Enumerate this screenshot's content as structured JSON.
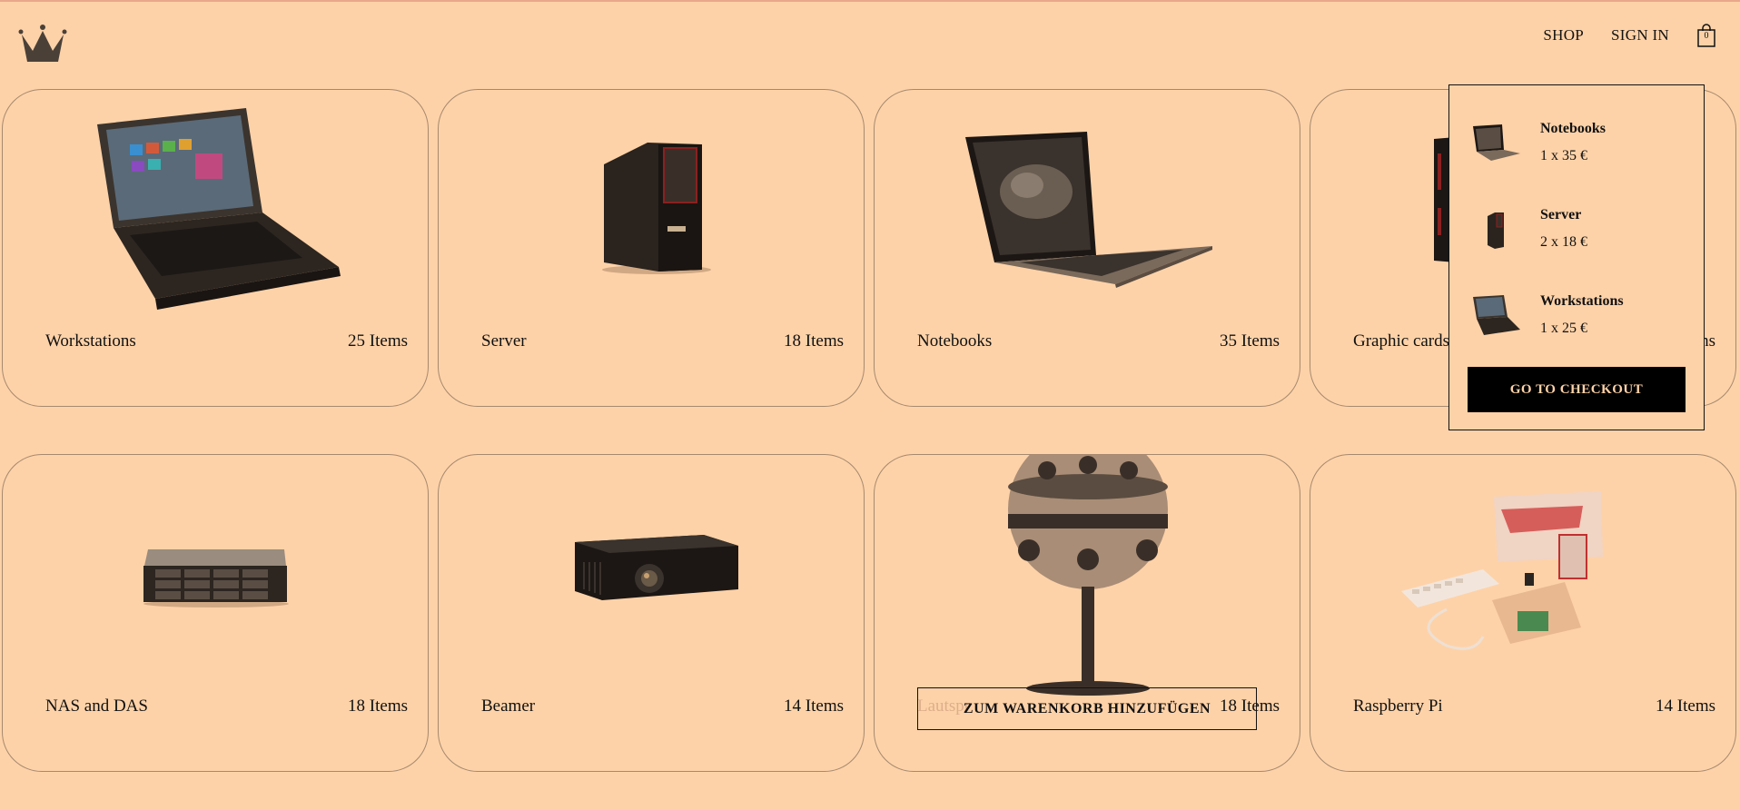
{
  "header": {
    "logo_icon": "crown-icon",
    "nav": {
      "shop": "SHOP",
      "sign_in": "SIGN IN"
    },
    "cart": {
      "icon": "shopping-bag-icon",
      "count": "0"
    }
  },
  "categories": [
    {
      "name": "Workstations",
      "count": "25 Items"
    },
    {
      "name": "Server",
      "count": "18 Items"
    },
    {
      "name": "Notebooks",
      "count": "35 Items"
    },
    {
      "name": "Graphic cards",
      "count": "ns"
    },
    {
      "name": "NAS and DAS",
      "count": "18 Items"
    },
    {
      "name": "Beamer",
      "count": "14 Items"
    },
    {
      "name": "Lautspr",
      "count": "18 Items"
    },
    {
      "name": "Raspberry Pi",
      "count": "14 Items"
    }
  ],
  "add_to_cart_button": "ZUM WARENKORB HINZUFÜGEN",
  "cart_dropdown": {
    "items": [
      {
        "name": "Notebooks",
        "qty": "1 x 35 €"
      },
      {
        "name": "Server",
        "qty": "2 x 18 €"
      },
      {
        "name": "Workstations",
        "qty": "1 x 25 €"
      }
    ],
    "checkout_label": "GO TO CHECKOUT"
  },
  "colors": {
    "background": "#fed2a8",
    "border": "#a5896f",
    "button": "#000000"
  }
}
